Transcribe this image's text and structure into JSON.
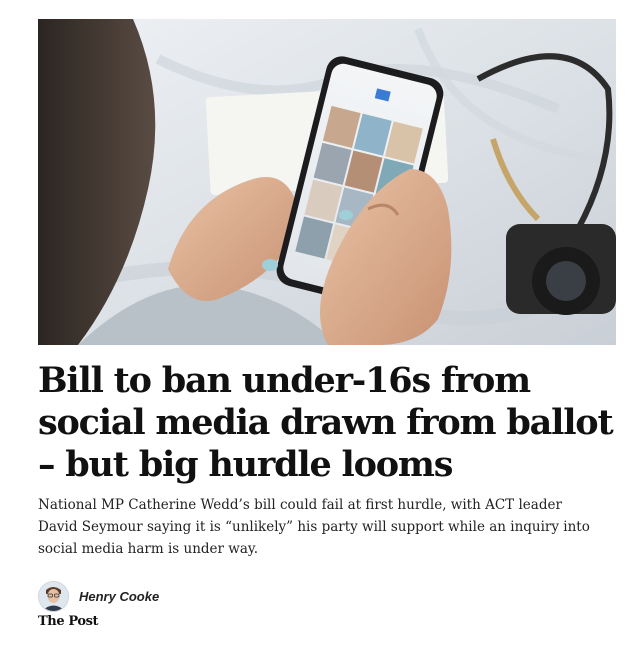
{
  "article": {
    "headline": "Bill to ban under-16s from social media drawn from ballot – but big hurdle looms",
    "standfirst": "National MP Catherine Wedd’s bill could fail at first hurdle, with ACT leader David Seymour saying it is “unlikely” his party will support while an inquiry into social media harm is under way.",
    "author": "Henry Cooke",
    "publication": "The Post"
  },
  "colors": {
    "text": "#111111",
    "background": "#ffffff"
  }
}
